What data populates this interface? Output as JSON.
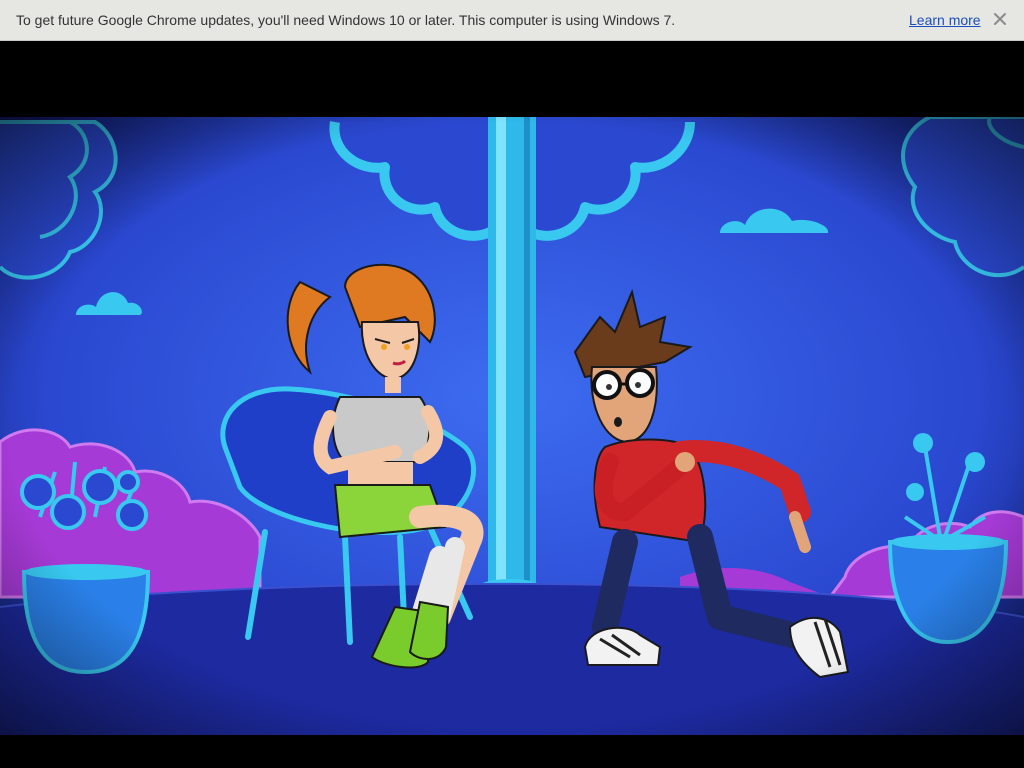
{
  "infobar": {
    "message": "To get future Google Chrome updates, you'll need Windows 10 or later. This computer is using Windows 7.",
    "learn_more": "Learn more",
    "close_icon": "close-icon",
    "colors": {
      "background": "#e6e6e2",
      "text": "#333333",
      "link": "#1a4fbf"
    }
  },
  "video": {
    "frame": {
      "description_icon": "cartoon-video-frame",
      "colors": {
        "sky": "#2a4fd8",
        "ground": "#1d2aa0",
        "accent_cyan": "#38c8f0",
        "accent_purple": "#a63ad6"
      }
    }
  }
}
